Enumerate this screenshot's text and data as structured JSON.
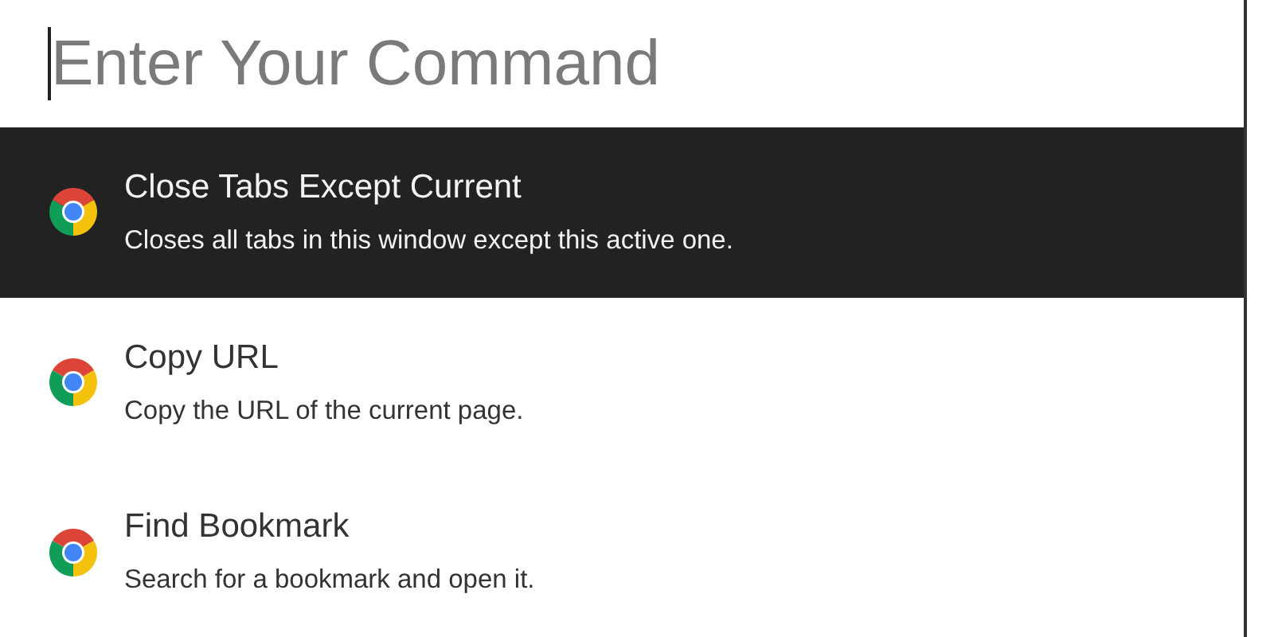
{
  "search": {
    "placeholder": "Enter Your Command"
  },
  "results": [
    {
      "title": "Close Tabs Except Current",
      "description": "Closes all tabs in this window except this active one.",
      "selected": true
    },
    {
      "title": "Copy URL",
      "description": "Copy the URL of the current page.",
      "selected": false
    },
    {
      "title": "Find Bookmark",
      "description": "Search for a bookmark and open it.",
      "selected": false
    }
  ]
}
